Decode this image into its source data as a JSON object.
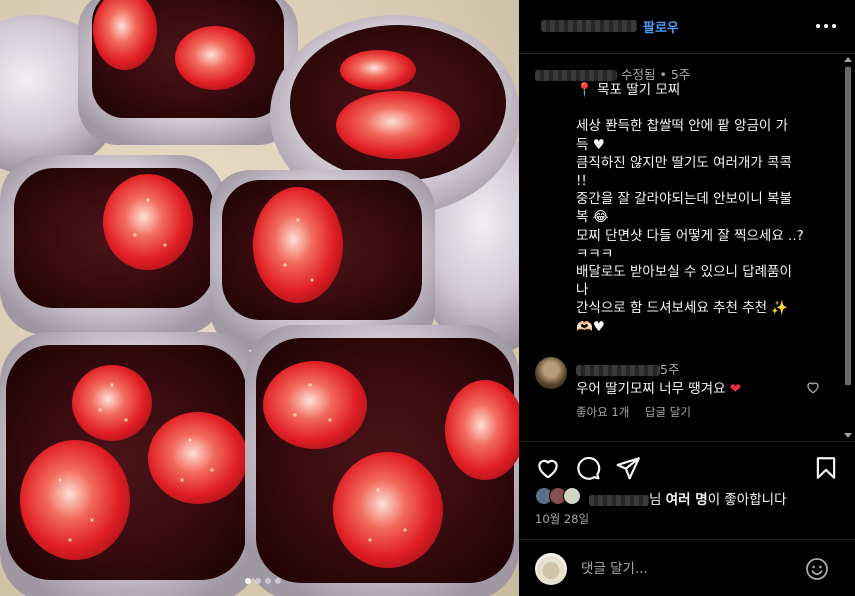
{
  "header": {
    "follow_label": "팔로우",
    "more_icon": "more-horizontal-icon"
  },
  "caption": {
    "edited_label": "수정됨",
    "separator": "•",
    "age": "5주",
    "lines": [
      "📍 목포 딸기 모찌",
      "",
      "세상 퐌득한 찹쌀떡 안에 팥 앙금이 가",
      "득 ♥",
      "큼직하진 않지만 딸기도 여러개가 콕콕",
      "!!",
      "중간을 잘 갈라야되는데 안보이니 복불",
      "복 😂",
      "모찌 단면샷 다들 어떻게 잘 찍으세요 ..?",
      "ㅋㅋㅋ",
      "배달로도 받아보실 수 있으니 답례품이",
      "나",
      "간식으로 함 드셔보세요 추천 추천 ✨",
      "🫶🏻♥"
    ]
  },
  "comment": {
    "age": "5주",
    "text": "우어 딸기모찌 너무 땡겨요",
    "heart": "❤",
    "likes_label": "좋아요 1개",
    "reply_label": "답글 달기"
  },
  "actions": {
    "like_icon": "heart-icon",
    "comment_icon": "comment-icon",
    "share_icon": "send-icon",
    "save_icon": "bookmark-icon"
  },
  "likes": {
    "suffix_name": "님",
    "and_label": "여러 명",
    "tail": "이 좋아합니다"
  },
  "date": "10월 28일",
  "comment_box": {
    "placeholder": "댓글 달기..."
  },
  "colors": {
    "background": "#000000",
    "link_blue": "#4b9cf8",
    "secondary_text": "#a8a8a8",
    "heart_red": "#ed2c45",
    "divider": "#262626"
  }
}
